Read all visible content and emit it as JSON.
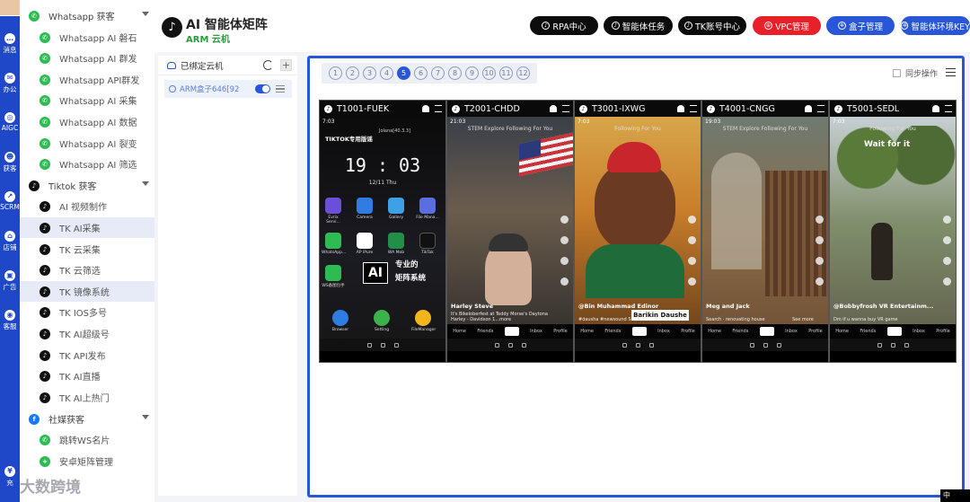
{
  "rail": {
    "items": [
      {
        "label": "消息"
      },
      {
        "label": "办公"
      },
      {
        "label": "AIGC"
      },
      {
        "label": "获客"
      },
      {
        "label": "SCRM"
      },
      {
        "label": "店铺"
      },
      {
        "label": "广告"
      },
      {
        "label": "客服"
      },
      {
        "label": "充"
      }
    ]
  },
  "menu": {
    "groups": [
      {
        "label": "Whatsapp 获客",
        "items": [
          "Whatsapp AI 磐石",
          "Whatsapp AI 群发",
          "Whatsapp API群发",
          "Whatsapp AI 采集",
          "Whatsapp AI 数据",
          "Whatsapp AI 裂变",
          "Whatsapp AI 筛选"
        ]
      },
      {
        "label": "Tiktok 获客",
        "items": [
          "AI 视频制作",
          "TK AI采集",
          "TK 云采集",
          "TK 云筛选",
          "TK 镜像系统",
          "TK IOS多号",
          "TK AI超级号",
          "TK API发布",
          "TK AI直播",
          "TK AI上热门"
        ]
      },
      {
        "label": "社媒获客",
        "items": [
          "跳转WS名片",
          "安卓矩阵管理"
        ]
      }
    ],
    "active": [
      "TK AI采集",
      "TK 镜像系统"
    ]
  },
  "header": {
    "title": "AI 智能体矩阵",
    "subtitle": "ARM 云机",
    "buttons": [
      {
        "label": "RPA中心",
        "style": "black"
      },
      {
        "label": "智能体任务",
        "style": "black"
      },
      {
        "label": "TK账号中心",
        "style": "black"
      },
      {
        "label": "VPC管理",
        "style": "red"
      },
      {
        "label": "盒子管理",
        "style": "blue"
      },
      {
        "label": "智能体环境KEY",
        "style": "blue"
      }
    ]
  },
  "tree": {
    "title": "已绑定云机",
    "device": "ARM盒子646[92"
  },
  "main": {
    "pages": [
      "1",
      "2",
      "3",
      "4",
      "5",
      "6",
      "7",
      "8",
      "9",
      "10",
      "11",
      "12"
    ],
    "active_page": "5",
    "sync_label": "同步操作",
    "phones": [
      {
        "id": "T1001-FUEK",
        "status": "7:03",
        "kind": "home",
        "home": {
          "title": "TIKTOK专用版谣",
          "lock_sub": "Jolana[40.3.3]",
          "clock": "19 : 03",
          "date": "12/11  Thu",
          "apps": [
            "Evrix Servi...",
            "Camera",
            "Gallery",
            "File Mana...",
            "WhatsApp...",
            "AP iPure",
            "WA Mob",
            "TikTok",
            "WS备图包手"
          ],
          "dock": [
            "Browser",
            "Setting",
            "FileManager"
          ],
          "ai_badge": "AI",
          "promo1": "专业的",
          "promo2": "矩阵系统"
        }
      },
      {
        "id": "T2001-CHDD",
        "status": "21:03",
        "kind": "feed",
        "top": "STEM  Explore  Following  For You",
        "user": "Harley Steve",
        "caption": "It's Bikeloberfest at Teddy Morse's Daytona Harley - Davidson 1...more"
      },
      {
        "id": "T3001-IXWG",
        "status": "7:03",
        "kind": "feed",
        "top": "Following  For You",
        "user": "@Bin Muhammad Edinor",
        "caption": "#dausha #newsound  See translation",
        "card": "Barikin Daushe"
      },
      {
        "id": "T4001-CNGG",
        "status": "19:03",
        "kind": "feed",
        "top": "STEM  Explore  Following  For You",
        "user": "Meg and Jack",
        "caption": "Search · renovating house",
        "more": "See more"
      },
      {
        "id": "T5001-SEDL",
        "status": "7:03",
        "kind": "feed",
        "top": "Following  For You",
        "user": "@Bobbyfrosh VR Entertainm...",
        "caption": "Dm if u wanna buy VR game",
        "overlay": "Wait for it"
      }
    ],
    "tab_labels": [
      "Home",
      "Friends",
      "",
      "Inbox",
      "Profile"
    ]
  },
  "footer": {
    "watermark": "大数跨境",
    "ime": "中"
  }
}
